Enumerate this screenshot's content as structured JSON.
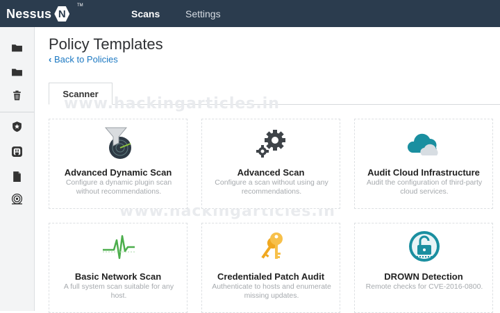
{
  "app": {
    "logo": "Nessus",
    "badge": "N",
    "tm": "TM"
  },
  "nav": {
    "scans": "Scans",
    "settings": "Settings"
  },
  "sidebar": {
    "icons": [
      "folder-icon",
      "folder-icon",
      "trash-icon",
      "shield-icon",
      "plug-icon",
      "file-icon",
      "radar-icon"
    ]
  },
  "page": {
    "title": "Policy Templates",
    "back": "Back to Policies"
  },
  "tabs": {
    "scanner": "Scanner"
  },
  "watermark": "www.hackingarticles.in",
  "cards": [
    {
      "name": "Advanced Dynamic Scan",
      "desc": "Configure a dynamic plugin scan without recommendations.",
      "icon": "funnel-radar-icon"
    },
    {
      "name": "Advanced Scan",
      "desc": "Configure a scan without using any recommendations.",
      "icon": "gears-icon"
    },
    {
      "name": "Audit Cloud Infrastructure",
      "desc": "Audit the configuration of third-party cloud services.",
      "icon": "cloud-icon"
    },
    {
      "name": "Basic Network Scan",
      "desc": "A full system scan suitable for any host.",
      "icon": "pulse-icon"
    },
    {
      "name": "Credentialed Patch Audit",
      "desc": "Authenticate to hosts and enumerate missing updates.",
      "icon": "keys-icon"
    },
    {
      "name": "DROWN Detection",
      "desc": "Remote checks for CVE-2016-0800.",
      "icon": "unlock-icon"
    }
  ],
  "colors": {
    "topbar": "#2b3c4e",
    "link": "#1b78c2",
    "teal": "#1a8fa0",
    "gold": "#f0a820",
    "green": "#4cae4c"
  }
}
